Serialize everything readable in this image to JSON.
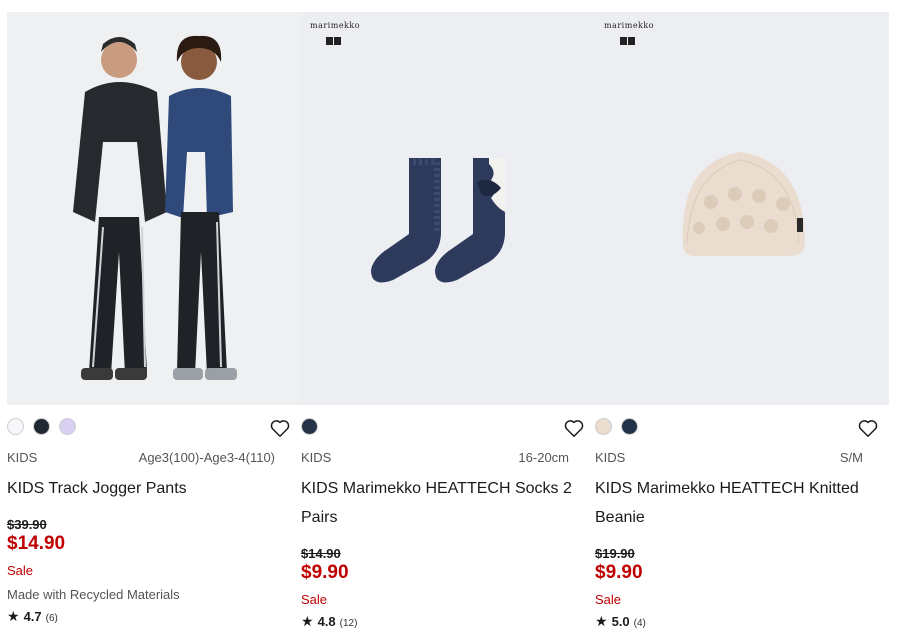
{
  "products": [
    {
      "image_alt": "Two kids wearing black track jogger pants and jackets",
      "brand_tag": "",
      "colors": [
        "#f6f6fb",
        "#1f2733",
        "#d8cff2"
      ],
      "category": "KIDS",
      "size": "Age3(100)-Age3-4(110)",
      "name": "KIDS Track Jogger Pants",
      "original_price": "$39.90",
      "sale_price": "$14.90",
      "sale_label": "Sale",
      "note": "Made with Recycled Materials",
      "rating": "4.7",
      "review_count": "(6)"
    },
    {
      "image_alt": "Navy patterned socks pair",
      "brand_tag": "marimekko",
      "colors": [
        "#263247"
      ],
      "category": "KIDS",
      "size": "16-20cm",
      "name": "KIDS Marimekko HEATTECH Socks 2 Pairs",
      "original_price": "$14.90",
      "sale_price": "$9.90",
      "sale_label": "Sale",
      "note": "",
      "rating": "4.8",
      "review_count": "(12)"
    },
    {
      "image_alt": "Beige knitted beanie",
      "brand_tag": "marimekko",
      "colors": [
        "#eadccf",
        "#23344a"
      ],
      "category": "KIDS",
      "size": "S/M",
      "name": "KIDS Marimekko HEATTECH Knitted Beanie",
      "original_price": "$19.90",
      "sale_price": "$9.90",
      "sale_label": "Sale",
      "note": "",
      "rating": "5.0",
      "review_count": "(4)"
    }
  ],
  "icons": {
    "favorite": "heart-outline-icon",
    "rating": "star-icon"
  }
}
